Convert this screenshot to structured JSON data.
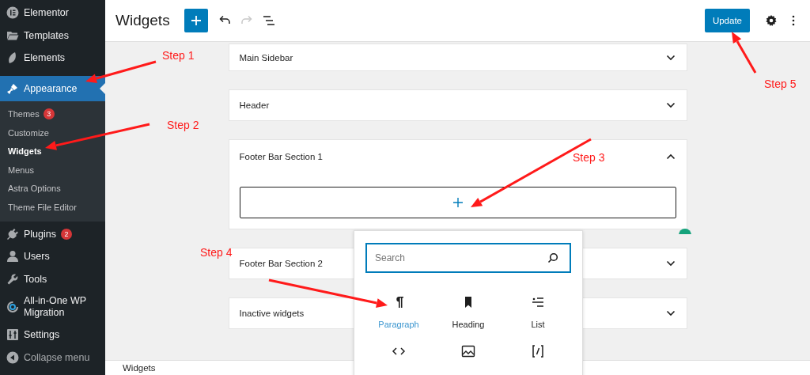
{
  "sidebar": {
    "items": [
      {
        "label": "Elementor",
        "kind": "elementor",
        "selected": false
      },
      {
        "label": "Templates",
        "kind": "folder",
        "selected": false
      },
      {
        "label": "Elements",
        "kind": "leaf",
        "selected": false
      },
      {
        "label": "Appearance",
        "kind": "brush",
        "selected": true,
        "submenu": [
          {
            "label": "Themes",
            "badge": "3",
            "selected": false
          },
          {
            "label": "Customize",
            "selected": false
          },
          {
            "label": "Widgets",
            "selected": true
          },
          {
            "label": "Menus",
            "selected": false
          },
          {
            "label": "Astra Options",
            "selected": false
          },
          {
            "label": "Theme File Editor",
            "selected": false
          }
        ]
      },
      {
        "label": "Plugins",
        "kind": "plug",
        "badge": "2",
        "selected": false
      },
      {
        "label": "Users",
        "kind": "user",
        "selected": false
      },
      {
        "label": "Tools",
        "kind": "wrench",
        "selected": false
      },
      {
        "label": "All-in-One WP Migration",
        "kind": "migration",
        "selected": false
      },
      {
        "label": "Settings",
        "kind": "sliders",
        "selected": false
      },
      {
        "label": "Collapse menu",
        "kind": "collapse",
        "selected": false
      }
    ]
  },
  "header": {
    "title": "Widgets",
    "redo_disabled": true,
    "update_button": "Update"
  },
  "widget_areas": [
    {
      "title": "Main Sidebar",
      "expanded": false
    },
    {
      "title": "Header",
      "expanded": false
    },
    {
      "title": "Footer Bar Section 1",
      "expanded": true
    },
    {
      "title": "Footer Bar Section 2",
      "expanded": false
    },
    {
      "title": "Inactive widgets",
      "expanded": false
    }
  ],
  "inserter": {
    "search": {
      "placeholder": "Search"
    },
    "blocks": [
      {
        "kind": "paragraph",
        "label": "Paragraph",
        "selected": true
      },
      {
        "kind": "heading",
        "label": "Heading",
        "selected": false
      },
      {
        "kind": "list",
        "label": "List",
        "selected": false
      },
      {
        "kind": "code",
        "selected": false
      },
      {
        "kind": "image",
        "selected": false
      },
      {
        "kind": "shortcode",
        "selected": false
      }
    ]
  },
  "status_bar": {
    "breadcrumb": "Widgets"
  },
  "annotations": [
    {
      "text": "Step 1"
    },
    {
      "text": "Step 2"
    },
    {
      "text": "Step 3"
    },
    {
      "text": "Step 4"
    },
    {
      "text": "Step 5"
    }
  ]
}
